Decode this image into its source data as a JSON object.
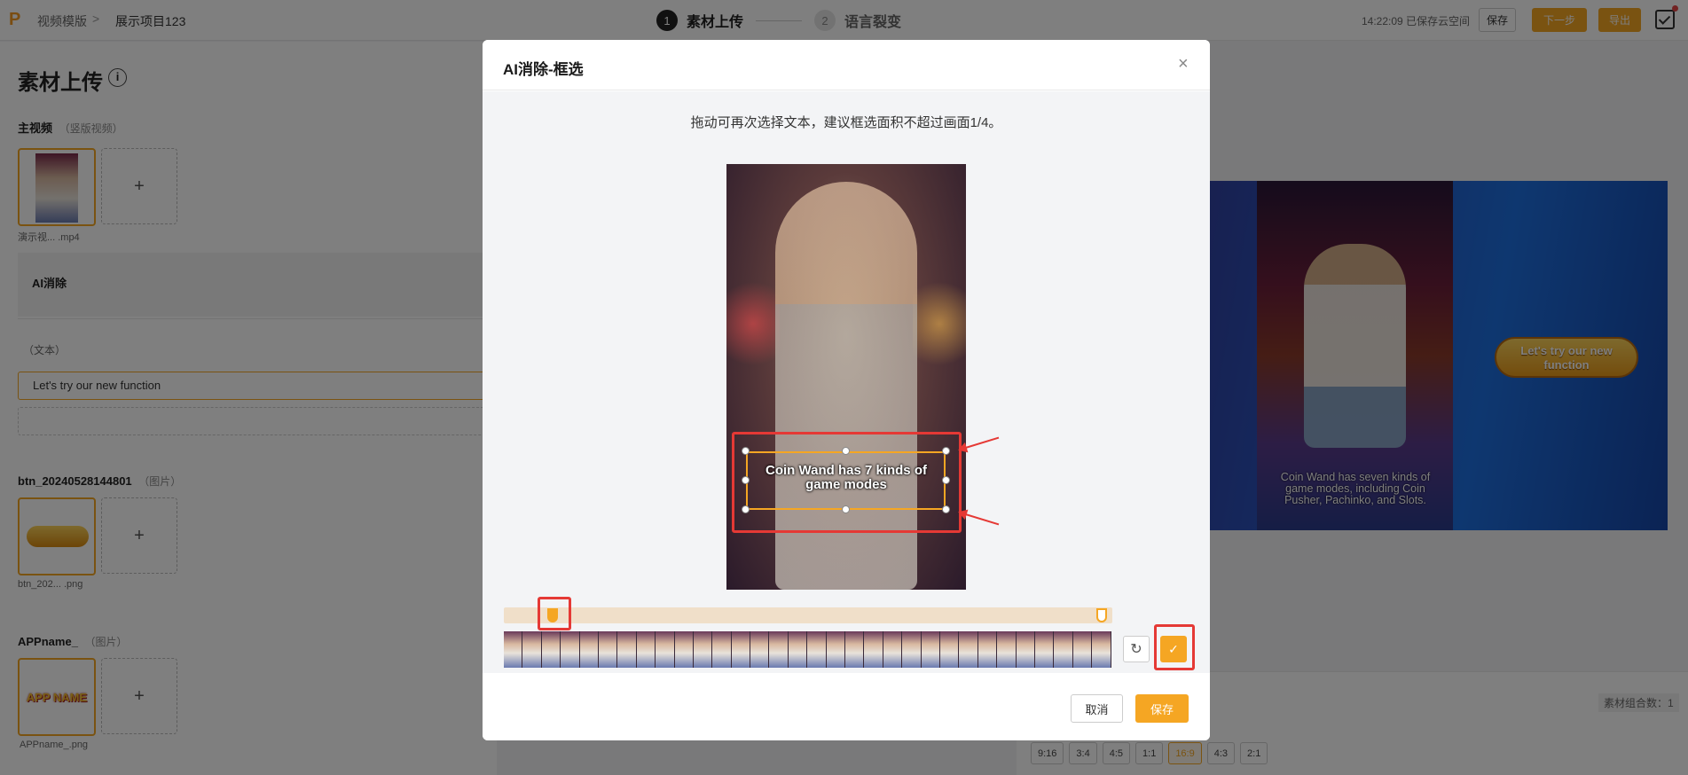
{
  "topbar": {
    "logo": "P",
    "breadcrumb_1": "视频模版",
    "breadcrumb_sep": ">",
    "breadcrumb_2": "展示项目123",
    "step1_num": "1",
    "step1_label": "素材上传",
    "step2_num": "2",
    "step2_label": "语言裂变",
    "save_status": "14:22:09 已保存云空间",
    "save_label": "保存",
    "next_label": "下一步",
    "export_label": "导出",
    "accent": "#f5a623"
  },
  "left": {
    "title": "素材上传",
    "main_video_label": "主视频",
    "main_video_hint": "（竖版视频）",
    "main_video_file": "演示视...   .mp4",
    "add_symbol": "+",
    "ai_remove_label": "AI消除",
    "text_label": "（文本）",
    "text_value": "Let's try our new function",
    "btn_label": "btn_20240528144801",
    "btn_hint": "（图片）",
    "btn_file": "btn_202...   .png",
    "appname_label": "APPname_",
    "appname_hint": "（图片）",
    "appname_file": "APPname_.png",
    "appname_logo_text": "APP NAME"
  },
  "preview": {
    "caption": "Coin Wand has seven kinds of game modes, including Coin Pusher, Pachinko, and Slots.",
    "cta": "Let's try our new function",
    "combo_label": "素材组合数：1",
    "ratios": [
      "9:16",
      "3:4",
      "4:5",
      "1:1",
      "16:9",
      "4:3",
      "2:1"
    ],
    "active_ratio": "16:9"
  },
  "modal": {
    "title": "AI消除-框选",
    "close": "×",
    "instruction": "拖动可再次选择文本，建议框选面积不超过画面1/4。",
    "video_caption": "Coin Wand has 7 kinds of game modes",
    "cancel_label": "取消",
    "save_label": "保存",
    "reset_icon": "↻",
    "confirm_icon": "✓"
  }
}
